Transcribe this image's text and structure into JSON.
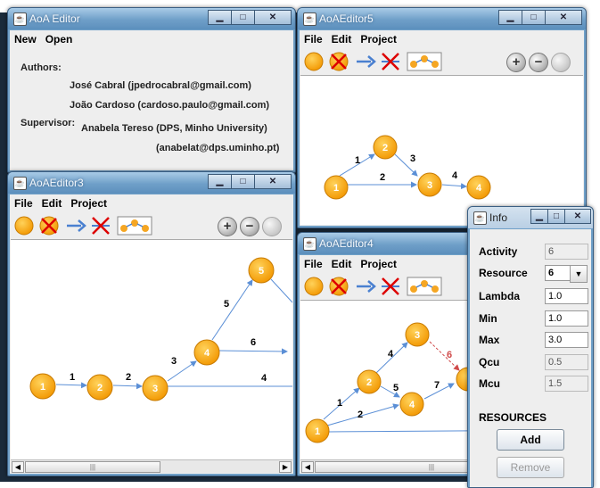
{
  "about": {
    "title": "AoA Editor",
    "menu": [
      "New",
      "Open"
    ],
    "authors_label": "Authors:",
    "author1": "José Cabral (jpedrocabral@gmail.com)",
    "author2": "João Cardoso (cardoso.paulo@gmail.com)",
    "supervisor_label": "Supervisor:",
    "supervisor_name": "Anabela Tereso (DPS, Minho University)",
    "supervisor_email": "(anabelat@dps.uminho.pt)"
  },
  "editor5": {
    "title": "AoAEditor5",
    "menu": [
      "File",
      "Edit",
      "Project"
    ],
    "nodes": [
      "1",
      "2",
      "3",
      "4"
    ],
    "edges": [
      "1",
      "2",
      "3",
      "4"
    ]
  },
  "editor3": {
    "title": "AoAEditor3",
    "menu": [
      "File",
      "Edit",
      "Project"
    ],
    "nodes": [
      "1",
      "2",
      "3",
      "4",
      "5"
    ],
    "edges": [
      "1",
      "2",
      "3",
      "4",
      "5",
      "6"
    ]
  },
  "editor4": {
    "title": "AoAEditor4",
    "menu": [
      "File",
      "Edit",
      "Project"
    ],
    "nodes": [
      "1",
      "2",
      "3",
      "4"
    ],
    "edges": [
      "1",
      "2",
      "4",
      "5",
      "6",
      "7"
    ]
  },
  "info": {
    "title": "Info",
    "activity_label": "Activity",
    "activity": "6",
    "resource_label": "Resource",
    "resource": "6",
    "lambda_label": "Lambda",
    "lambda": "1.0",
    "min_label": "Min",
    "min": "1.0",
    "max_label": "Max",
    "max": "3.0",
    "qcu_label": "Qcu",
    "qcu": "0.5",
    "mcu_label": "Mcu",
    "mcu": "1.5",
    "resources_label": "RESOURCES",
    "add_label": "Add",
    "remove_label": "Remove"
  },
  "icons": {
    "node_color": "#f5a623",
    "arrow_color": "#5b8fd6",
    "window_icon": "java-cup-icon"
  },
  "toolbar_items": [
    "add-node-icon",
    "delete-node-icon",
    "add-arrow-icon",
    "delete-arrow-icon",
    "network-icon",
    "zoom-in-icon",
    "zoom-out-icon",
    "zoom-reset-icon"
  ]
}
